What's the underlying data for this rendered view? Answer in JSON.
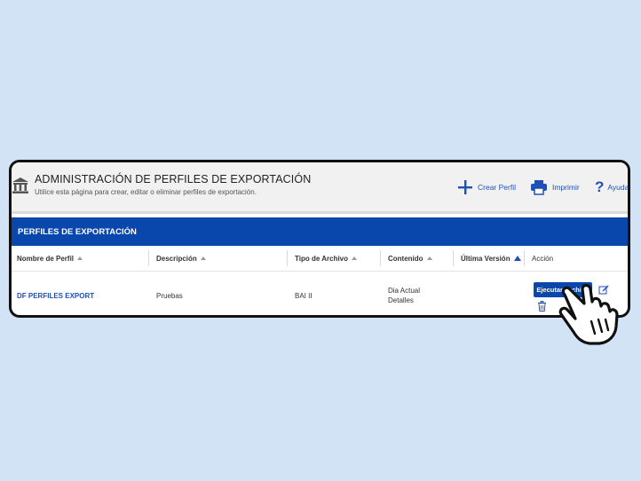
{
  "header": {
    "title": "ADMINISTRACIÓN DE PERFILES DE EXPORTACIÓN",
    "subtitle": "Utilice esta página para crear, editar o eliminar perfiles de exportación.",
    "actions": {
      "create_label": "Crear Perfil",
      "print_label": "Imprimir",
      "help_label": "Ayuda"
    }
  },
  "section": {
    "title": "PERFILES DE EXPORTACIÓN"
  },
  "table": {
    "columns": [
      "Nombre de Perfil",
      "Descripción",
      "Tipo de Archivo",
      "Contenido",
      "Última Versión",
      "Acción"
    ],
    "rows": [
      {
        "name": "DF PERFILES EXPORT",
        "description": "Pruebas",
        "file_type": "BAI II",
        "content_line1": "Dia Actual",
        "content_line2": "Detalles",
        "last_version": "",
        "action_button": "Ejecutar Archivo"
      }
    ]
  },
  "colors": {
    "background": "#d3e3f6",
    "accent": "#0a47ad",
    "link": "#1f50b5"
  },
  "icons": [
    "bank-icon",
    "plus-icon",
    "printer-icon",
    "help-icon",
    "sort-icon",
    "edit-icon",
    "trash-icon",
    "pointer-hand-icon"
  ]
}
